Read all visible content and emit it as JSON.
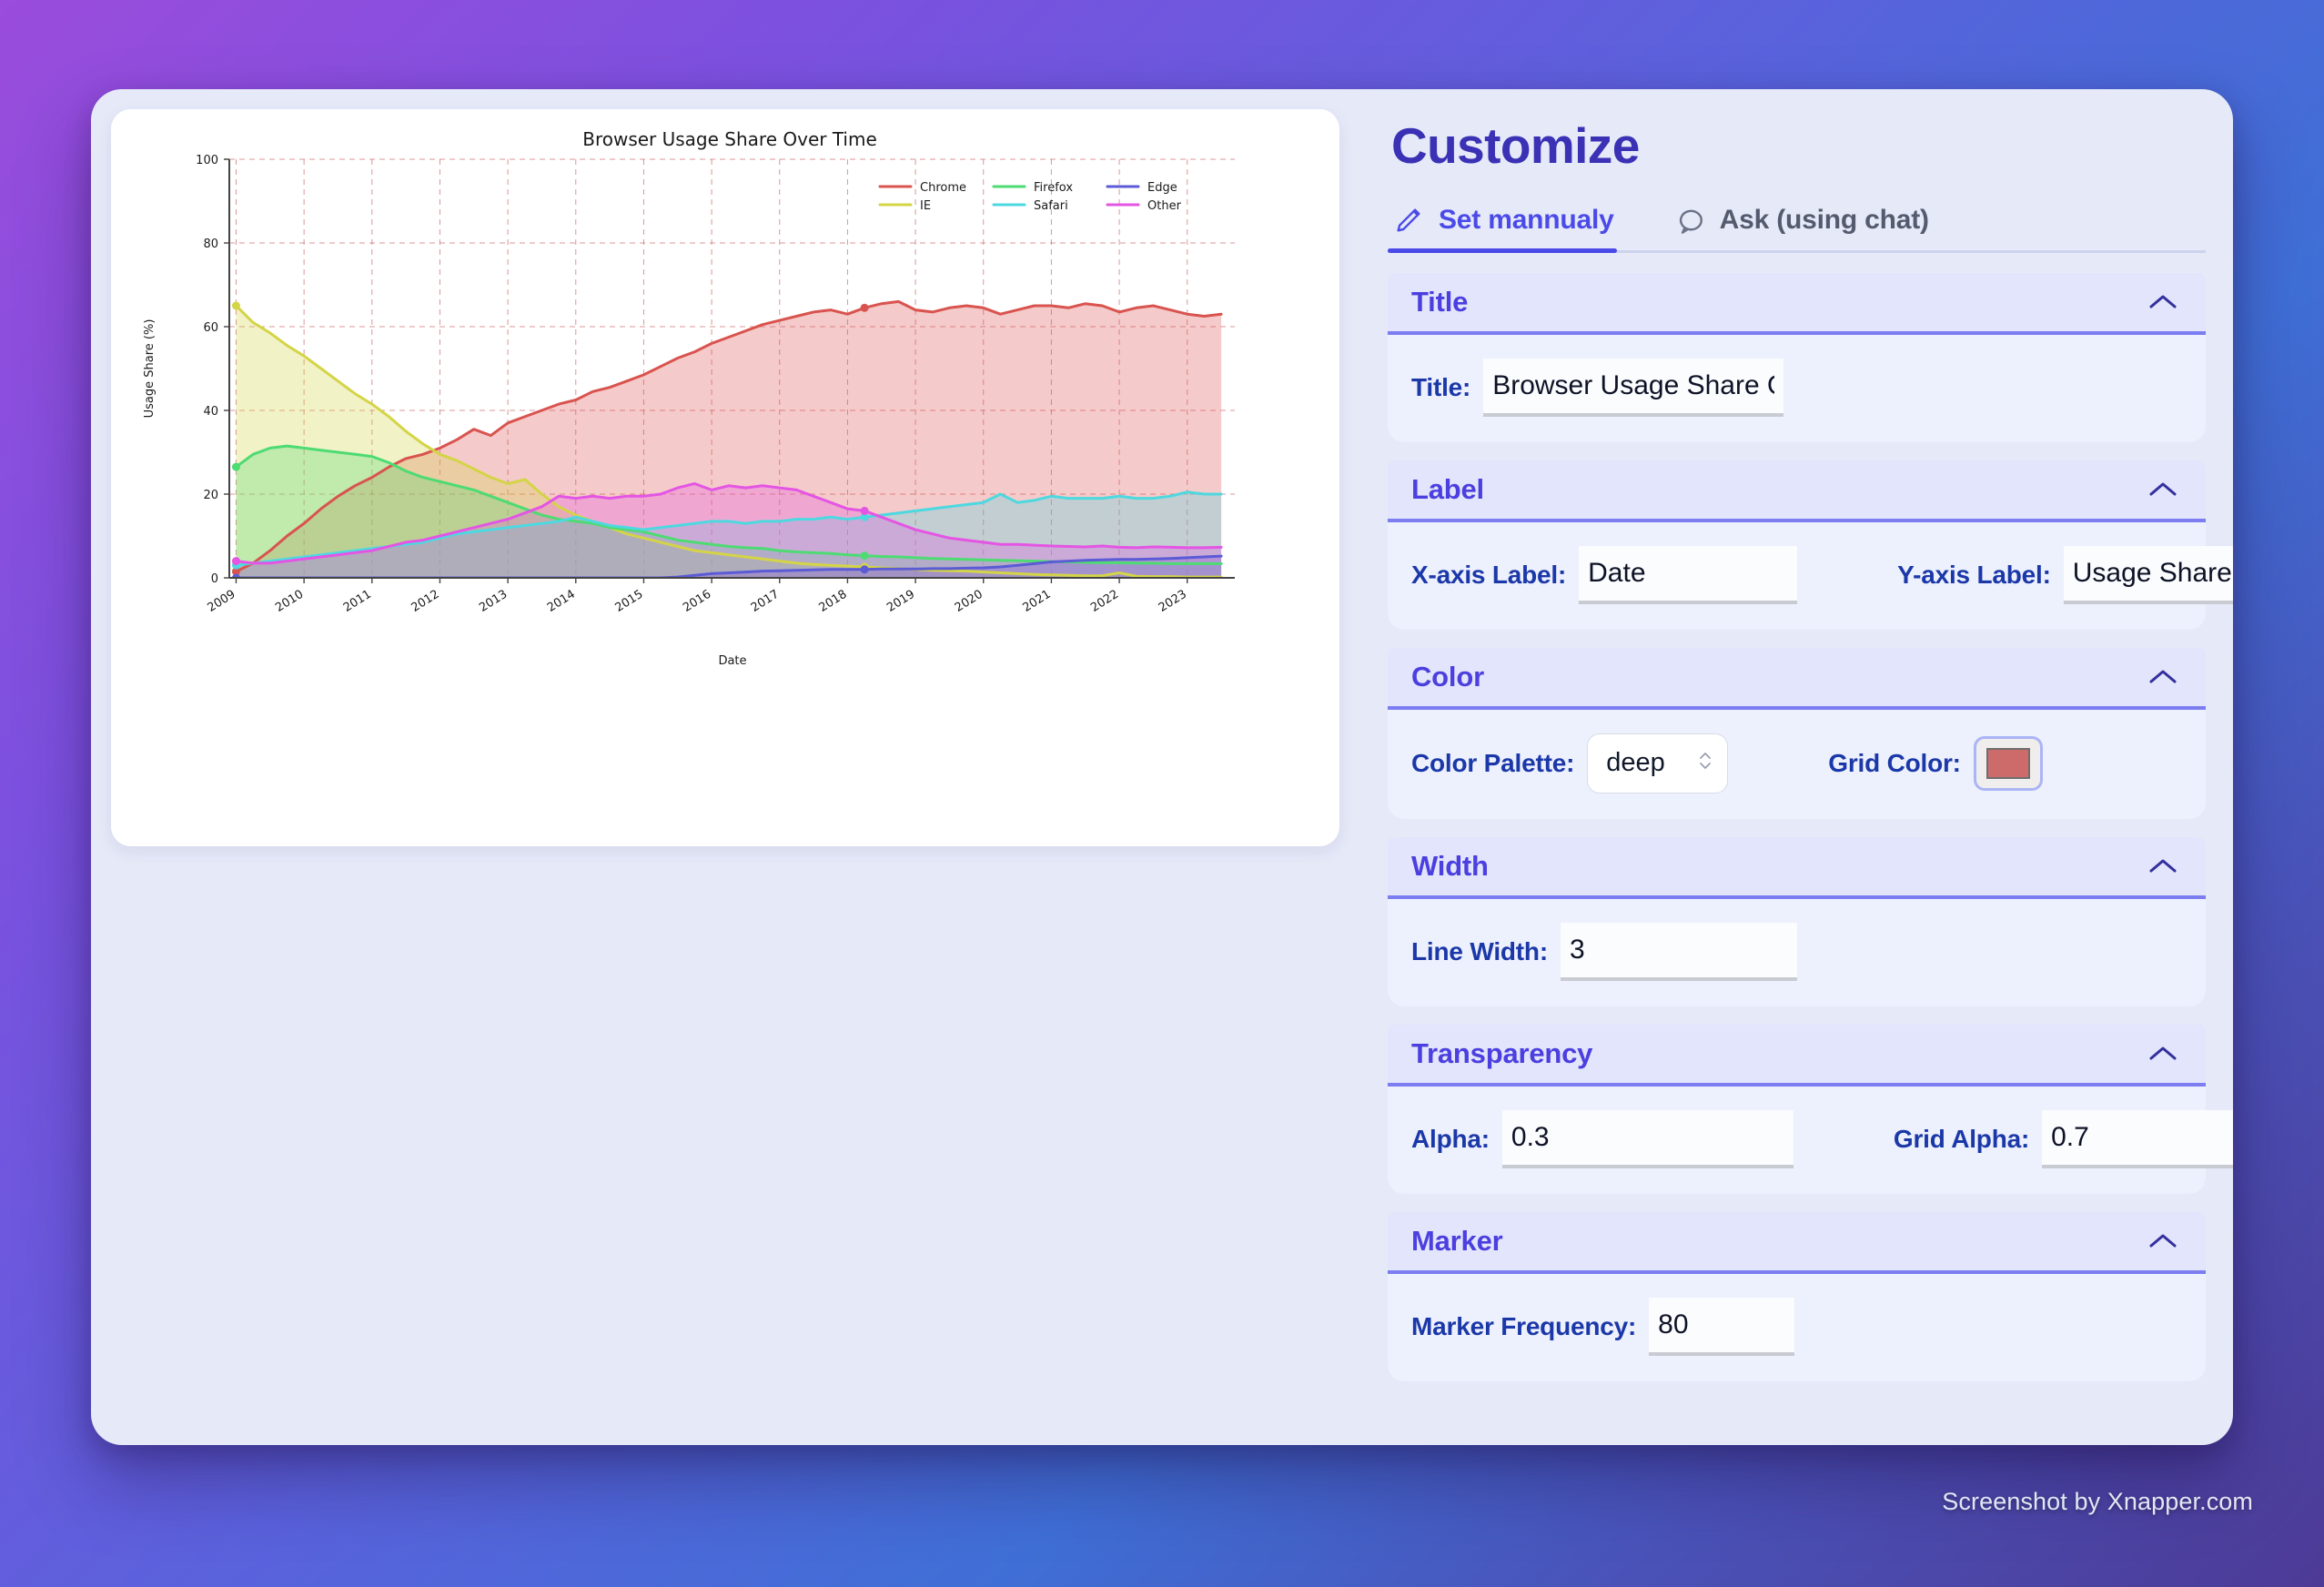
{
  "panel": {
    "title": "Customize",
    "tabs": [
      {
        "label": "Set mannualy",
        "icon": "pencil-icon",
        "active": true
      },
      {
        "label": "Ask (using chat)",
        "icon": "chat-bubble-icon",
        "active": false
      }
    ],
    "sections": {
      "title": {
        "name": "Title",
        "chevron": "chevron-up-icon",
        "fields": {
          "title_label": "Title:",
          "title_value": "Browser Usage Share Ov"
        }
      },
      "label": {
        "name": "Label",
        "chevron": "chevron-up-icon",
        "fields": {
          "x_label": "X-axis Label:",
          "x_value": "Date",
          "y_label": "Y-axis Label:",
          "y_value": "Usage Share (%)"
        }
      },
      "color": {
        "name": "Color",
        "chevron": "chevron-up-icon",
        "fields": {
          "palette_label": "Color Palette:",
          "palette_value": "deep",
          "grid_color_label": "Grid Color:",
          "grid_color_value": "#cd6b6b"
        }
      },
      "width": {
        "name": "Width",
        "chevron": "chevron-up-icon",
        "fields": {
          "line_width_label": "Line Width:",
          "line_width_value": "3"
        }
      },
      "transparency": {
        "name": "Transparency",
        "chevron": "chevron-up-icon",
        "fields": {
          "alpha_label": "Alpha:",
          "alpha_value": "0.3",
          "grid_alpha_label": "Grid Alpha:",
          "grid_alpha_value": "0.7"
        }
      },
      "marker": {
        "name": "Marker",
        "chevron": "chevron-up-icon",
        "fields": {
          "marker_freq_label": "Marker Frequency:",
          "marker_freq_value": "80"
        }
      }
    }
  },
  "watermark": "Screenshot by Xnapper.com",
  "chart_data": {
    "type": "area",
    "title": "Browser Usage Share Over Time",
    "xlabel": "Date",
    "ylabel": "Usage Share (%)",
    "xlim": [
      2008.9,
      2023.7
    ],
    "ylim": [
      0,
      100
    ],
    "yticks": [
      0,
      20,
      40,
      60,
      80,
      100
    ],
    "xticks": [
      "2009",
      "2010",
      "2011",
      "2012",
      "2013",
      "2014",
      "2015",
      "2016",
      "2017",
      "2018",
      "2019",
      "2020",
      "2021",
      "2022",
      "2023"
    ],
    "grid": true,
    "grid_color": "#cd6b6b",
    "grid_alpha": 0.7,
    "alpha": 0.3,
    "line_width": 3,
    "legend_position": "upper right",
    "legend_ncol": 3,
    "palette": "deep",
    "x": [
      2009.0,
      2009.25,
      2009.5,
      2009.75,
      2010.0,
      2010.25,
      2010.5,
      2010.75,
      2011.0,
      2011.25,
      2011.5,
      2011.75,
      2012.0,
      2012.25,
      2012.5,
      2012.75,
      2013.0,
      2013.25,
      2013.5,
      2013.75,
      2014.0,
      2014.25,
      2014.5,
      2014.75,
      2015.0,
      2015.25,
      2015.5,
      2015.75,
      2016.0,
      2016.25,
      2016.5,
      2016.75,
      2017.0,
      2017.25,
      2017.5,
      2017.75,
      2018.0,
      2018.25,
      2018.5,
      2018.75,
      2019.0,
      2019.25,
      2019.5,
      2019.75,
      2020.0,
      2020.25,
      2020.5,
      2020.75,
      2021.0,
      2021.25,
      2021.5,
      2021.75,
      2022.0,
      2022.25,
      2022.5,
      2022.75,
      2023.0,
      2023.25,
      2023.5
    ],
    "series": [
      {
        "name": "Chrome",
        "color": "#d9534f",
        "values": [
          1.5,
          3.5,
          6.5,
          10.0,
          13.0,
          16.5,
          19.5,
          22.0,
          24.0,
          26.5,
          28.5,
          29.5,
          31.0,
          33.0,
          35.5,
          34.0,
          37.0,
          38.5,
          40.0,
          41.5,
          42.5,
          44.5,
          45.5,
          47.0,
          48.5,
          50.5,
          52.5,
          54.0,
          56.0,
          57.5,
          59.0,
          60.5,
          61.5,
          62.5,
          63.5,
          64.0,
          63.0,
          64.5,
          65.5,
          66.0,
          64.0,
          63.5,
          64.5,
          65.0,
          64.5,
          63.0,
          64.0,
          65.0,
          65.0,
          64.5,
          65.5,
          65.0,
          63.5,
          64.5,
          65.0,
          64.0,
          63.0,
          62.5,
          63.0
        ]
      },
      {
        "name": "IE",
        "color": "#d4d447",
        "values": [
          65.0,
          61.0,
          58.5,
          55.5,
          53.0,
          50.0,
          47.0,
          44.0,
          41.5,
          38.5,
          35.0,
          32.0,
          29.5,
          28.0,
          26.0,
          24.0,
          22.5,
          23.5,
          20.0,
          17.0,
          15.0,
          13.5,
          12.0,
          10.5,
          9.5,
          8.5,
          7.5,
          6.5,
          6.0,
          5.5,
          5.0,
          4.5,
          4.0,
          3.5,
          3.2,
          3.0,
          2.8,
          2.6,
          2.4,
          2.2,
          2.0,
          1.8,
          1.7,
          1.6,
          1.4,
          1.2,
          1.0,
          0.8,
          0.7,
          0.6,
          0.5,
          0.5,
          1.2,
          0.4,
          0.3,
          0.3,
          0.2,
          0.2,
          0.2
        ]
      },
      {
        "name": "Firefox",
        "color": "#4ddb72",
        "values": [
          26.5,
          29.5,
          31.0,
          31.5,
          31.0,
          30.5,
          30.0,
          29.5,
          29.0,
          27.5,
          25.5,
          24.0,
          23.0,
          22.0,
          21.0,
          19.5,
          18.0,
          16.5,
          15.0,
          14.0,
          13.5,
          13.0,
          12.0,
          11.5,
          11.0,
          10.0,
          9.0,
          8.5,
          8.0,
          7.5,
          7.2,
          7.0,
          6.5,
          6.2,
          6.0,
          5.8,
          5.5,
          5.3,
          5.1,
          5.0,
          4.8,
          4.6,
          4.5,
          4.4,
          4.3,
          4.2,
          4.1,
          4.0,
          3.9,
          3.8,
          3.7,
          3.6,
          3.6,
          3.5,
          3.5,
          3.4,
          3.4,
          3.4,
          3.4
        ]
      },
      {
        "name": "Safari",
        "color": "#4ed8e0",
        "values": [
          3.0,
          3.5,
          4.0,
          4.5,
          5.0,
          5.5,
          6.0,
          6.5,
          7.0,
          7.5,
          8.0,
          8.5,
          9.5,
          10.5,
          11.0,
          11.5,
          12.0,
          12.5,
          13.0,
          13.5,
          14.5,
          13.5,
          12.5,
          12.0,
          11.5,
          12.0,
          12.5,
          13.0,
          13.5,
          13.5,
          13.0,
          13.5,
          13.5,
          14.0,
          14.0,
          14.5,
          14.0,
          14.5,
          15.0,
          15.5,
          16.0,
          16.5,
          17.0,
          17.5,
          18.0,
          20.0,
          18.0,
          18.5,
          19.5,
          19.0,
          19.0,
          19.0,
          19.5,
          19.0,
          19.0,
          19.5,
          20.5,
          20.0,
          20.0
        ]
      },
      {
        "name": "Edge",
        "color": "#5b5bd6",
        "values": [
          0,
          0,
          0,
          0,
          0,
          0,
          0,
          0,
          0,
          0,
          0,
          0,
          0,
          0,
          0,
          0,
          0,
          0,
          0,
          0,
          0,
          0,
          0,
          0,
          0,
          0,
          0.2,
          0.6,
          1.0,
          1.2,
          1.4,
          1.6,
          1.7,
          1.8,
          1.9,
          2.0,
          2.0,
          2.0,
          2.1,
          2.1,
          2.1,
          2.2,
          2.2,
          2.3,
          2.4,
          2.6,
          3.0,
          3.4,
          3.8,
          4.0,
          4.2,
          4.3,
          4.4,
          4.4,
          4.5,
          4.6,
          4.8,
          5.0,
          5.2
        ]
      },
      {
        "name": "Other",
        "color": "#e455e4",
        "values": [
          4.0,
          3.5,
          3.5,
          4.0,
          4.5,
          5.0,
          5.5,
          6.0,
          6.5,
          7.5,
          8.5,
          9.0,
          10.0,
          11.0,
          12.0,
          13.0,
          14.0,
          15.5,
          17.0,
          19.5,
          19.0,
          19.5,
          19.0,
          19.5,
          19.5,
          20.0,
          21.5,
          22.5,
          21.0,
          22.0,
          21.5,
          22.0,
          21.5,
          21.0,
          19.5,
          18.0,
          16.5,
          16.0,
          14.5,
          13.0,
          11.5,
          10.5,
          9.5,
          9.0,
          8.5,
          8.0,
          8.0,
          7.8,
          7.6,
          7.5,
          7.4,
          7.6,
          7.3,
          7.2,
          7.4,
          7.3,
          7.2,
          7.2,
          7.3
        ]
      }
    ]
  }
}
